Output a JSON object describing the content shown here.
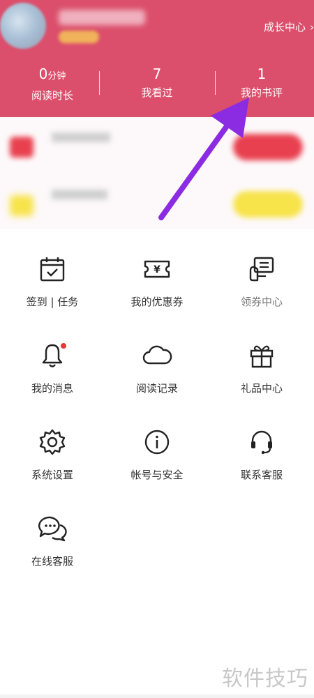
{
  "header": {
    "growth_center": "成长中心",
    "growth_chevron": "›",
    "stats": [
      {
        "value": "0",
        "unit": "分钟",
        "label": "阅读时长"
      },
      {
        "value": "7",
        "label": "我看过"
      },
      {
        "value": "1",
        "label": "我的书评"
      }
    ]
  },
  "menu": [
    {
      "label": "签到 | 任务",
      "icon": "calendar-check-icon"
    },
    {
      "label": "我的优惠券",
      "icon": "yuan-ticket-icon"
    },
    {
      "label": "领券中心",
      "icon": "coupon-center-icon"
    },
    {
      "label": "我的消息",
      "icon": "bell-icon"
    },
    {
      "label": "阅读记录",
      "icon": "cloud-icon"
    },
    {
      "label": "礼品中心",
      "icon": "gift-icon"
    },
    {
      "label": "系统设置",
      "icon": "gear-icon"
    },
    {
      "label": "帐号与安全",
      "icon": "info-icon"
    },
    {
      "label": "联系客服",
      "icon": "headset-icon"
    },
    {
      "label": "在线客服",
      "icon": "chat-bubbles-icon"
    }
  ],
  "colors": {
    "header": "#dc4f6c",
    "arrow": "#8b2be2",
    "badge": "#e53935"
  },
  "watermark": "软件技巧"
}
